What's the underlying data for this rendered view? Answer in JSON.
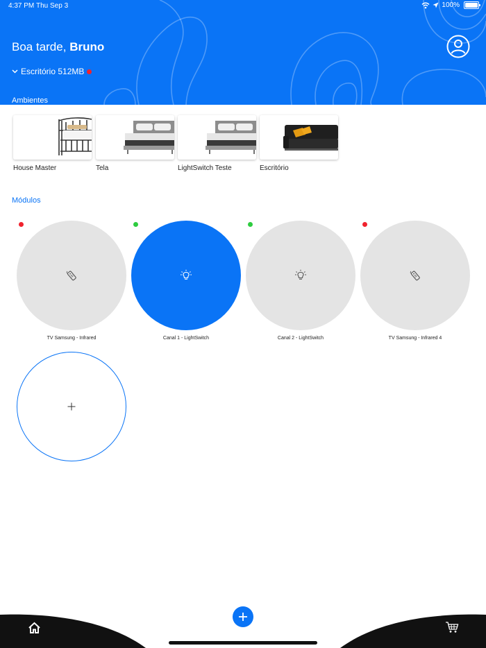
{
  "status": {
    "time": "4:37 PM",
    "date": "Thu Sep 3",
    "battery": "100%"
  },
  "header": {
    "greeting_prefix": "Boa tarde,",
    "user_name": "Bruno",
    "location": "Escritório 512MB",
    "location_status_color": "#f0232e"
  },
  "ambientes": {
    "title": "Ambientes",
    "rooms": [
      {
        "name": "House Master",
        "image": "metal-bed-image"
      },
      {
        "name": "Tela",
        "image": "bed-image"
      },
      {
        "name": "LightSwitch Teste",
        "image": "bed-image"
      },
      {
        "name": "Escritório",
        "image": "sofa-image"
      }
    ]
  },
  "modulos": {
    "title": "Módulos",
    "items": [
      {
        "name": "TV Samsung - Infrared",
        "icon": "remote-icon",
        "online": false,
        "active": false
      },
      {
        "name": "Canal 1 - LightSwitch",
        "icon": "lightbulb-icon",
        "online": true,
        "active": true
      },
      {
        "name": "Canal 2 - LightSwitch",
        "icon": "lightbulb-icon",
        "online": true,
        "active": false
      },
      {
        "name": "TV Samsung - Infrared 4",
        "icon": "remote-icon",
        "online": false,
        "active": false
      }
    ],
    "add_icon": "plus-icon"
  },
  "colors": {
    "accent": "#0a74f6",
    "offline": "#f0232e",
    "online": "#2ecc40",
    "module_inactive": "#e4e4e4"
  }
}
